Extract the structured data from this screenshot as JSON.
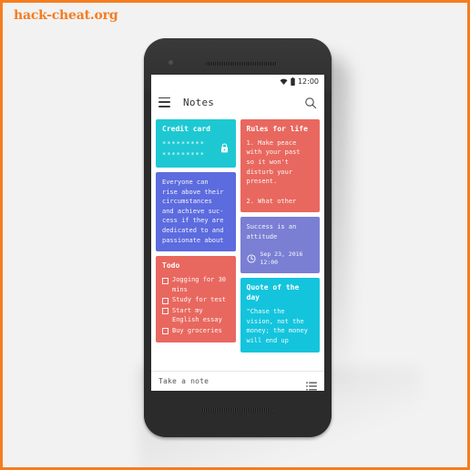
{
  "watermark": "hack-cheat.org",
  "theme": {
    "frame_border": "#f57c20",
    "page_bg": "#f2f2f2",
    "phone_body": "#2b2b2b",
    "screen_bg": "#ffffff",
    "note_teal": "#1ec8d2",
    "note_salmon": "#e8685f",
    "note_blue": "#5c6bde",
    "note_purple": "#7a7fd4",
    "note_cyan": "#14c4dd"
  },
  "statusbar": {
    "time": "12:00",
    "wifi_icon": "wifi-icon",
    "battery_icon": "battery-icon"
  },
  "appbar": {
    "menu_icon": "hamburger-menu-icon",
    "title": "Notes",
    "search_icon": "search-icon"
  },
  "notes": {
    "column_left": [
      {
        "id": "credit-card",
        "title": "Credit\ncard",
        "color": "#1ec8d2",
        "locked": true,
        "lock_icon": "lock-icon",
        "masked_lines": [
          "*********",
          "*********"
        ]
      },
      {
        "id": "everyone-can-rise",
        "title": "",
        "color": "#5c6bde",
        "body": "Everyone can\nrise above their\ncircumstances\nand achieve suc-\ncess if they are\ndedicated to and\npassionate about"
      },
      {
        "id": "todo",
        "title": "Todo",
        "color": "#e8685f",
        "items": [
          "Jogging for 30 mins",
          "Study for test",
          "Start my English essay",
          "Buy groceries"
        ]
      }
    ],
    "column_right": [
      {
        "id": "rules-for-life",
        "title": "Rules for life",
        "color": "#e8685f",
        "body": "1. Make peace\nwith your past\nso it won't\ndisturb your\npresent.\n\n2. What other"
      },
      {
        "id": "success-attitude",
        "title": "",
        "color": "#7a7fd4",
        "body": "Success is an\nattitude",
        "reminder": {
          "clock_icon": "clock-icon",
          "date": "Sep 23, 2016",
          "time": "12:00"
        }
      },
      {
        "id": "quote-of-the-day",
        "title": "Quote of the\nday",
        "color": "#14c4dd",
        "body": "\"Chase the\nvision, not the\nmoney; the money\nwill end up"
      }
    ]
  },
  "bottombar": {
    "take_note_label": "Take a note",
    "view_toggle_icon": "list-view-icon"
  }
}
